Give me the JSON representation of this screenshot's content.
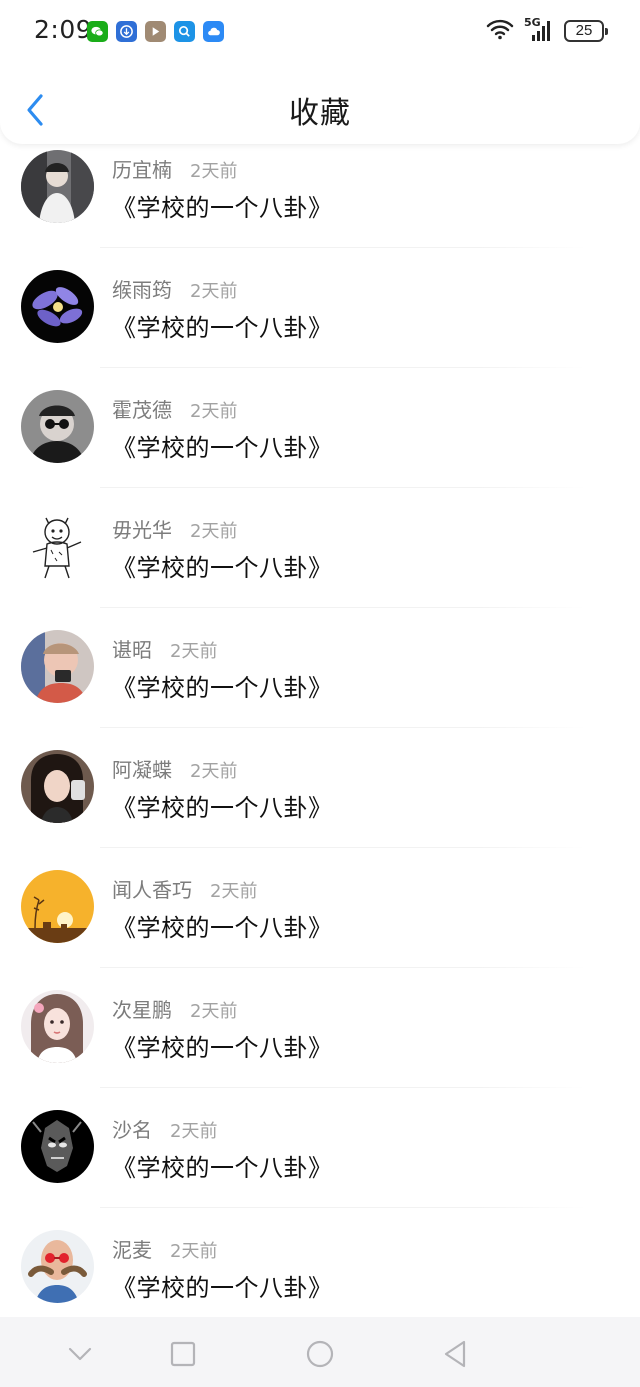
{
  "status_bar": {
    "time": "2:09",
    "battery": "25",
    "network": "5G",
    "app_icons": [
      {
        "name": "wechat-icon",
        "color": "#1aad19"
      },
      {
        "name": "download-app-icon",
        "color": "#2f6fd6"
      },
      {
        "name": "video-app-icon",
        "color": "#a08a73"
      },
      {
        "name": "search-app-icon",
        "color": "#1d93e6"
      },
      {
        "name": "cloud-app-icon",
        "color": "#2c8af5"
      }
    ]
  },
  "header": {
    "title": "收藏",
    "accent_color": "#2d8cf0"
  },
  "favorites": [
    {
      "user": "历宜楠",
      "time": "2天前",
      "title": "《学校的一个八卦》",
      "avatar": "person-mirror-selfie"
    },
    {
      "user": "缑雨筠",
      "time": "2天前",
      "title": "《学校的一个八卦》",
      "avatar": "purple-flower"
    },
    {
      "user": "霍茂德",
      "time": "2天前",
      "title": "《学校的一个八卦》",
      "avatar": "man-sunglasses"
    },
    {
      "user": "毋光华",
      "time": "2天前",
      "title": "《学校的一个八卦》",
      "avatar": "cartoon-tiger"
    },
    {
      "user": "谌昭",
      "time": "2天前",
      "title": "《学校的一个八卦》",
      "avatar": "child-with-phone"
    },
    {
      "user": "阿凝蝶",
      "time": "2天前",
      "title": "《学校的一个八卦》",
      "avatar": "girl-selfie"
    },
    {
      "user": "闻人香巧",
      "time": "2天前",
      "title": "《学校的一个八卦》",
      "avatar": "sunset"
    },
    {
      "user": "次星鹏",
      "time": "2天前",
      "title": "《学校的一个八卦》",
      "avatar": "girl-portrait"
    },
    {
      "user": "沙名",
      "time": "2天前",
      "title": "《学校的一个八卦》",
      "avatar": "dark-mask"
    },
    {
      "user": "泥麦",
      "time": "2天前",
      "title": "《学校的一个八卦》",
      "avatar": "bald-man-mustache"
    }
  ]
}
